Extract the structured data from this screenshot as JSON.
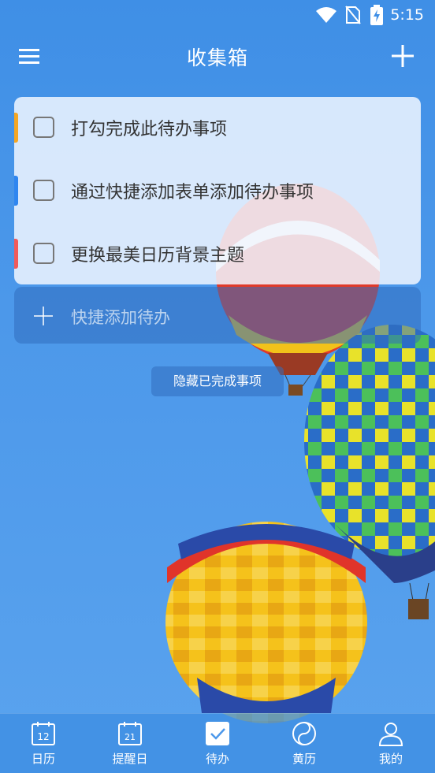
{
  "status_bar": {
    "time": "5:15"
  },
  "header": {
    "title": "收集箱"
  },
  "todos": [
    {
      "text": "打勾完成此待办事项",
      "color": "#f5a623"
    },
    {
      "text": "通过快捷添加表单添加待办事项",
      "color": "#2f86f0"
    },
    {
      "text": "更换最美日历背景主题",
      "color": "#f25a5a"
    }
  ],
  "quick_add": {
    "placeholder": "快捷添加待办"
  },
  "hide_done": {
    "label": "隐藏已完成事项"
  },
  "bottom_nav": {
    "items": [
      {
        "label": "日历",
        "icon": "calendar-icon",
        "day": "12"
      },
      {
        "label": "提醒日",
        "icon": "reminder-icon",
        "day": "21"
      },
      {
        "label": "待办",
        "icon": "todo-icon"
      },
      {
        "label": "黄历",
        "icon": "almanac-icon"
      },
      {
        "label": "我的",
        "icon": "profile-icon"
      }
    ],
    "active_index": 2
  },
  "colors": {
    "accent": "#4c98ea",
    "text": "#333333"
  }
}
